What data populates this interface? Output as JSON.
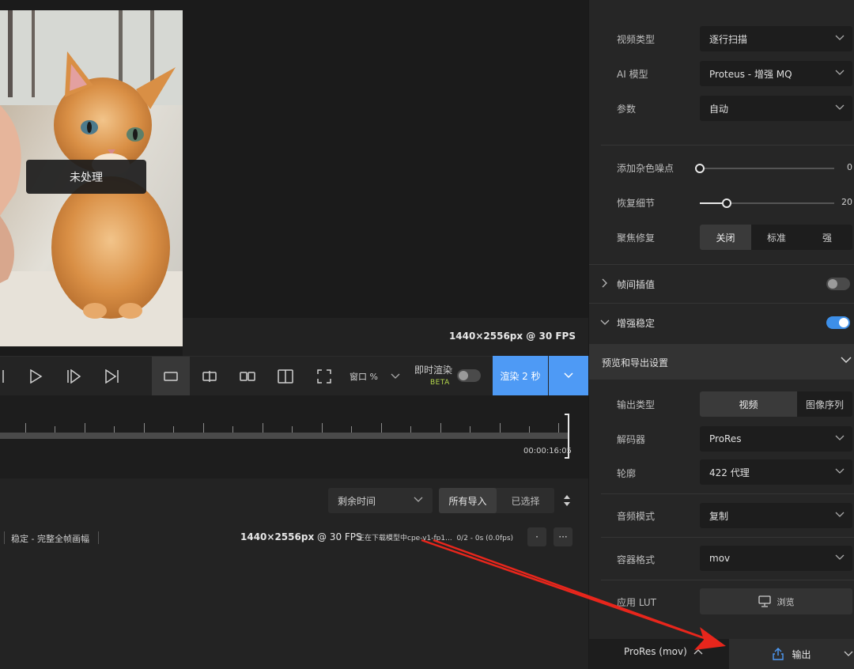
{
  "preview": {
    "unprocessed_label": "未处理",
    "resolution": "1440×2556px @ 30 FPS"
  },
  "toolbar": {
    "zoom_label": "窗口 %",
    "instant_render_label": "即时渲染",
    "beta_label": "BETA",
    "instant_render_on": false,
    "render_button_label": "渲染 2 秒"
  },
  "timeline": {
    "end_time": "00:00:16:05"
  },
  "queue": {
    "sort_value": "剩余时间",
    "filters": [
      {
        "label": "所有导入",
        "active": true
      },
      {
        "label": "已选择",
        "active": false
      }
    ],
    "job": {
      "description": "稳定 - 完整全帧画幅",
      "resolution_bold": "1440×2556px",
      "resolution_rest": " @ 30 FPS",
      "status": "正在下载模型中cpe-v1-fp1...",
      "progress": "0/2 - 0s (0.0fps)",
      "more_label": "···",
      "dot_label": "·"
    }
  },
  "settings": {
    "video_type": {
      "label": "视频类型",
      "value": "逐行扫描"
    },
    "ai_model": {
      "label": "AI 模型",
      "value": "Proteus - 增强 MQ"
    },
    "params": {
      "label": "参数",
      "value": "自动"
    },
    "add_noise": {
      "label": "添加杂色噪点",
      "value": 0,
      "value_text": "0"
    },
    "recover_detail": {
      "label": "恢复细节",
      "value": 20,
      "value_text": "20"
    },
    "focus_fix": {
      "label": "聚焦修复",
      "options": [
        "关闭",
        "标准",
        "强"
      ],
      "selected": 0
    },
    "frame_interp": {
      "label": "帧间插值",
      "enabled": false
    },
    "stabilize": {
      "label": "增强稳定",
      "enabled": true
    },
    "export_section_title": "预览和导出设置",
    "output_type": {
      "label": "输出类型",
      "options": [
        "视频",
        "图像序列"
      ],
      "selected": 0
    },
    "encoder": {
      "label": "解码器",
      "value": "ProRes"
    },
    "profile": {
      "label": "轮廓",
      "value": "422 代理"
    },
    "audio_mode": {
      "label": "音频模式",
      "value": "复制"
    },
    "container": {
      "label": "容器格式",
      "value": "mov"
    },
    "lut": {
      "label": "应用 LUT",
      "browse_label": "浏览"
    },
    "codec_summary": "ProRes (mov)",
    "export_label": "输出"
  },
  "colors": {
    "accent_blue": "#4e9af5",
    "annotation_red": "#e8261c",
    "beta_green": "#b6d94c"
  }
}
